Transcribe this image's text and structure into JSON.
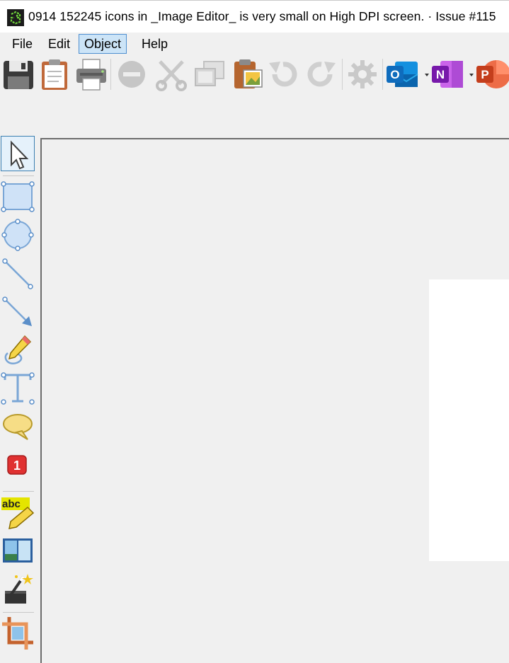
{
  "window": {
    "title": "0914 152245 icons in _Image Editor_ is very small on High DPI screen. · Issue #115",
    "app_icon": "greenshot-icon"
  },
  "menu": {
    "items": [
      {
        "label": "File"
      },
      {
        "label": "Edit"
      },
      {
        "label": "Object",
        "active": true
      },
      {
        "label": "Help"
      }
    ]
  },
  "toolbar": {
    "buttons": [
      {
        "icon": "save-icon",
        "enabled": true
      },
      {
        "icon": "clipboard-icon",
        "enabled": true
      },
      {
        "icon": "print-icon",
        "enabled": true
      },
      {
        "icon": "delete-icon",
        "enabled": false
      },
      {
        "icon": "cut-icon",
        "enabled": false
      },
      {
        "icon": "copy-icon",
        "enabled": false
      },
      {
        "icon": "paste-icon",
        "enabled": true
      },
      {
        "icon": "undo-icon",
        "enabled": false
      },
      {
        "icon": "redo-icon",
        "enabled": false
      },
      {
        "icon": "settings-icon",
        "enabled": false
      },
      {
        "icon": "outlook-icon",
        "enabled": true,
        "letter": "O",
        "dropdown": true
      },
      {
        "icon": "onenote-icon",
        "enabled": true,
        "letter": "N",
        "dropdown": true
      },
      {
        "icon": "powerpoint-icon",
        "enabled": true,
        "letter": "P"
      }
    ]
  },
  "tools": {
    "items": [
      {
        "icon": "select-cursor-icon",
        "selected": true
      },
      {
        "icon": "rectangle-tool-icon"
      },
      {
        "icon": "ellipse-tool-icon"
      },
      {
        "icon": "line-tool-icon"
      },
      {
        "icon": "arrow-tool-icon"
      },
      {
        "icon": "freehand-tool-icon"
      },
      {
        "icon": "text-tool-icon"
      },
      {
        "icon": "speechbubble-tool-icon"
      },
      {
        "icon": "step-label-tool-icon",
        "text": "1"
      },
      {
        "icon": "highlight-tool-icon",
        "text": "abc"
      },
      {
        "icon": "obfuscate-tool-icon"
      },
      {
        "icon": "magic-wand-icon"
      },
      {
        "icon": "crop-tool-icon"
      }
    ]
  },
  "colors": {
    "accent": "#3c7fb1",
    "menu_active_bg": "#cce4f7",
    "outlook": "#0f6cbd",
    "onenote": "#7719aa",
    "powerpoint": "#c43e1c",
    "step_badge": "#e03131",
    "highlight": "#e4e400"
  }
}
